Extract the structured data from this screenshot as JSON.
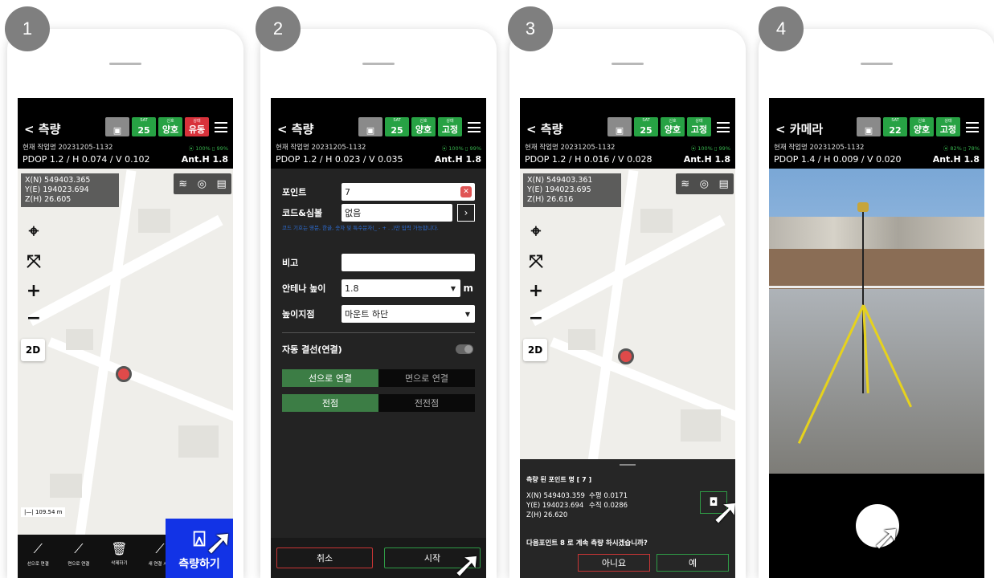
{
  "steps": [
    "1",
    "2",
    "3",
    "4"
  ],
  "common": {
    "sat_count": "25",
    "sat_label": "SAT",
    "sig_label": "신호",
    "sig_value": "양호",
    "state_label": "상태",
    "job": "현재 작업명 20231205-1132",
    "batt": "⦿ 100%  ▯ 99%",
    "anth": "Ant.H 1.8"
  },
  "screen1": {
    "title": "< 측량",
    "state_value": "유동",
    "pdop": "PDOP 1.2 / H 0.074 / V 0.102",
    "coord_n": "X(N) 549403.365",
    "coord_e": "Y(E) 194023.694",
    "coord_z": "Z(H) 26.605",
    "scale": "|—| 109.54 m",
    "bottom": [
      {
        "icon": "⟋",
        "label": "선으로 연결"
      },
      {
        "icon": "⟋",
        "label": "면으로 연결"
      },
      {
        "icon": "🗑",
        "label": "삭제하기"
      },
      {
        "icon": "⟋",
        "label": "새 연결 시작"
      }
    ],
    "measure_label": "측량하기"
  },
  "screen2": {
    "title": "< 측량",
    "state_value": "고정",
    "pdop": "PDOP 1.2 / H 0.023 / V 0.035",
    "point_label": "포인트",
    "point_value": "7",
    "code_label": "코드&심볼",
    "code_value": "없음",
    "hint": "코드 기호는 영문, 한글, 숫자 및 특수문자(_ - + . ,)만 입력 가능합니다.",
    "note_label": "비고",
    "ant_label": "안테나 높이",
    "ant_value": "1.8",
    "ant_unit": "m",
    "height_label": "높이지점",
    "height_value": "마운트 하단",
    "auto_label": "자동 결선(연결)",
    "seg1": [
      "선으로 연결",
      "면으로 연결"
    ],
    "seg2": [
      "전점",
      "전전점"
    ],
    "cancel": "취소",
    "start": "시작"
  },
  "screen3": {
    "title": "< 측량",
    "state_value": "고정",
    "pdop": "PDOP 1.2 / H 0.016 / V 0.028",
    "coord_n": "X(N) 549403.361",
    "coord_e": "Y(E) 194023.695",
    "coord_z": "Z(H) 26.616",
    "sheet_title": "측량 된 포인트 명 [ 7 ]",
    "res_n": "X(N) 549403.359",
    "res_e": "Y(E) 194023.694",
    "res_z": "Z(H) 26.620",
    "horiz": "수평 0.0171",
    "vert": "수직 0.0286",
    "question": "다음포인트 8 로 계속 측량 하시겠습니까?",
    "no": "아니요",
    "yes": "예"
  },
  "screen4": {
    "title": "< 카메라",
    "sat_count": "22",
    "state_value": "고정",
    "batt": "⦿ 82%  ▯ 78%",
    "pdop": "PDOP 1.4 / H 0.009 / V 0.020"
  }
}
